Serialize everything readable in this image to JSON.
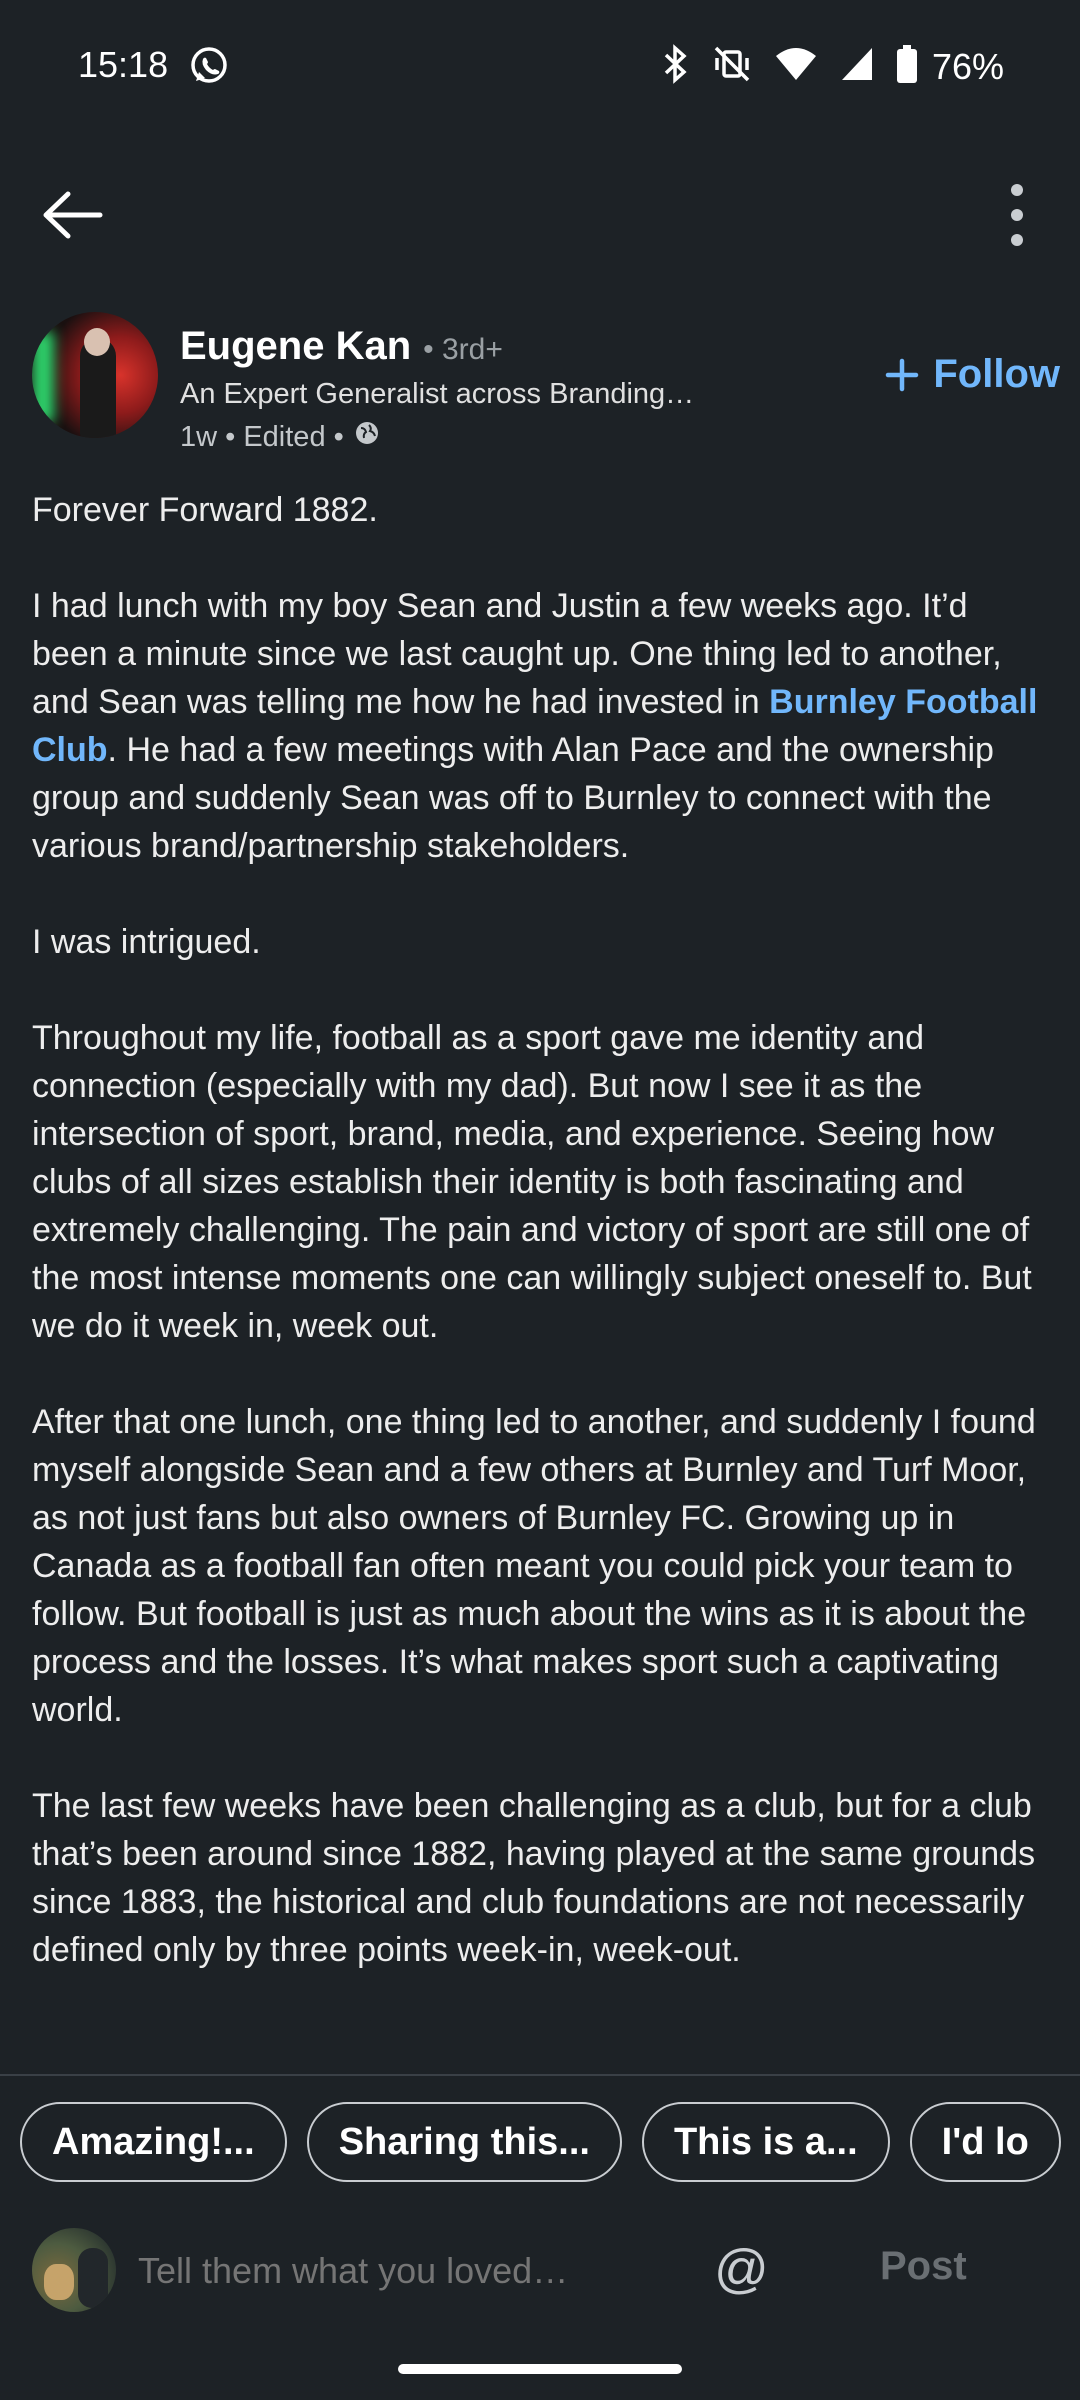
{
  "status_bar": {
    "time": "15:18",
    "battery": "76%",
    "icons": [
      "whatsapp-icon",
      "bluetooth-icon",
      "vibrate-off-icon",
      "wifi-icon",
      "signal-icon",
      "battery-icon"
    ]
  },
  "app_bar": {
    "back_icon": "arrow-left-icon",
    "more_icon": "more-vertical-icon"
  },
  "author": {
    "name": "Eugene Kan",
    "degree": "• 3rd+",
    "headline": "An Expert Generalist across Branding…",
    "meta": "1w • Edited •",
    "visibility_icon": "globe-icon",
    "follow_label": "Follow"
  },
  "post": {
    "p1": "Forever Forward 1882.",
    "p2_before": "I had lunch with my boy Sean and Justin a few weeks ago. It’d been a minute since we last caught up. One thing led to another, and Sean was telling me how he had invested in ",
    "p2_link": "Burnley Football Club",
    "p2_after": ". He had a few meetings with Alan Pace and the ownership group and suddenly Sean was off to Burnley to connect with the various brand/partnership stakeholders.",
    "p3": "I was intrigued.",
    "p4": "Throughout my life, football as a sport gave me identity and connection (especially with my dad). But now I see it as the intersection of sport, brand, media, and experience. Seeing how clubs of all sizes establish their identity is both fascinating and extremely challenging. The pain and victory of sport are still one of the most intense moments one can willingly subject oneself to. But we do it week in, week out.",
    "p5": "After that one lunch, one thing led to another, and suddenly I found myself alongside Sean and a few others at Burnley and Turf Moor, as not just fans but also owners of Burnley FC. Growing up in Canada as a football fan often meant you could pick your team to follow. But football is just as much about the wins as it is about the process and the losses. It’s what makes sport such a captivating world.",
    "p6": "The last few weeks have been challenging as a club, but for a club that’s been around since 1882, having played at the same grounds since 1883, the historical and club foundations are not necessarily defined only by three points week-in, week-out."
  },
  "suggestions": [
    "Amazing!...",
    "Sharing this...",
    "This is a...",
    "I'd lo"
  ],
  "comment_bar": {
    "placeholder": "Tell them what you loved…",
    "mention_label": "@",
    "post_label": "Post"
  },
  "colors": {
    "background": "#1d2226",
    "link": "#71b7fb",
    "text": "#ededed"
  }
}
